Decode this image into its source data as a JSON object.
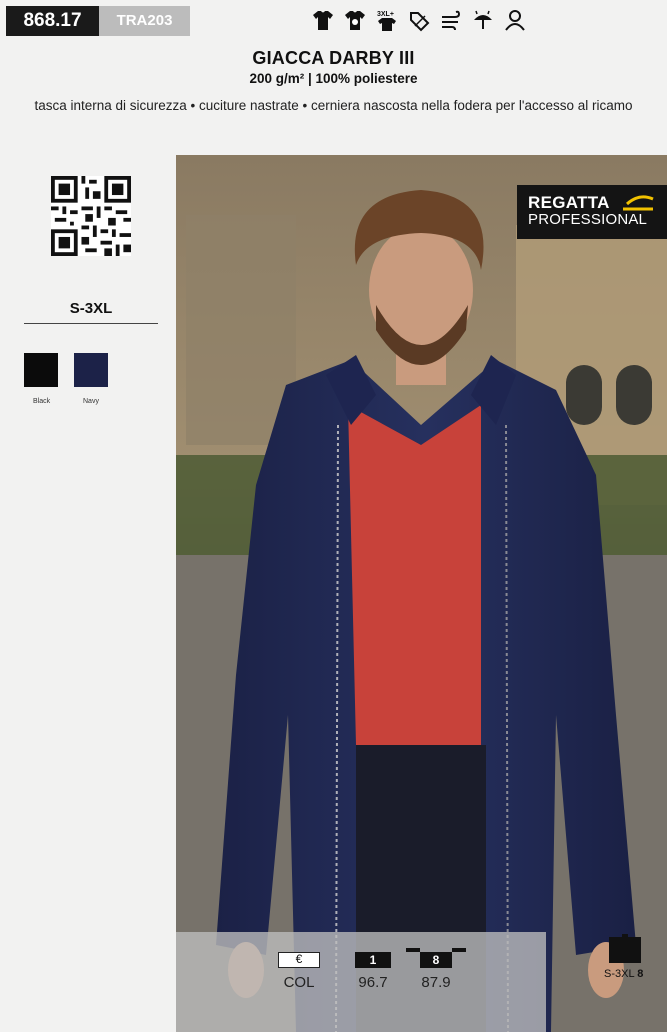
{
  "header": {
    "catalog_code": "868.17",
    "model_code": "TRA203",
    "icons": [
      "tshirt-icon",
      "embroidery-tshirt-icon",
      "size-3xl-plus-icon",
      "discount-tag-icon",
      "wind-icon",
      "rain-icon",
      "user-outline-icon"
    ]
  },
  "product": {
    "title": "GIACCA DARBY III",
    "spec": "200 g/m² | 100% poliestere",
    "features": "tasca interna di sicurezza • cuciture nastrate • cerniera nascosta nella fodera per l'accesso al ricamo"
  },
  "sidebar": {
    "size_range": "S-3XL",
    "colors": [
      {
        "name": "Black",
        "hex": "#0b0b0b"
      },
      {
        "name": "Navy",
        "hex": "#1c2248"
      }
    ]
  },
  "brand": {
    "line1": "REGATTA",
    "line2": "PROFESSIONAL",
    "accent": "#f2c200"
  },
  "pricing": {
    "currency_label": "€",
    "col_label": "COL",
    "tiers": [
      {
        "qty": "1",
        "price": "96.7"
      },
      {
        "qty": "8",
        "price": "87.9"
      }
    ]
  },
  "carton": {
    "size": "S-3XL",
    "qty": "8"
  }
}
